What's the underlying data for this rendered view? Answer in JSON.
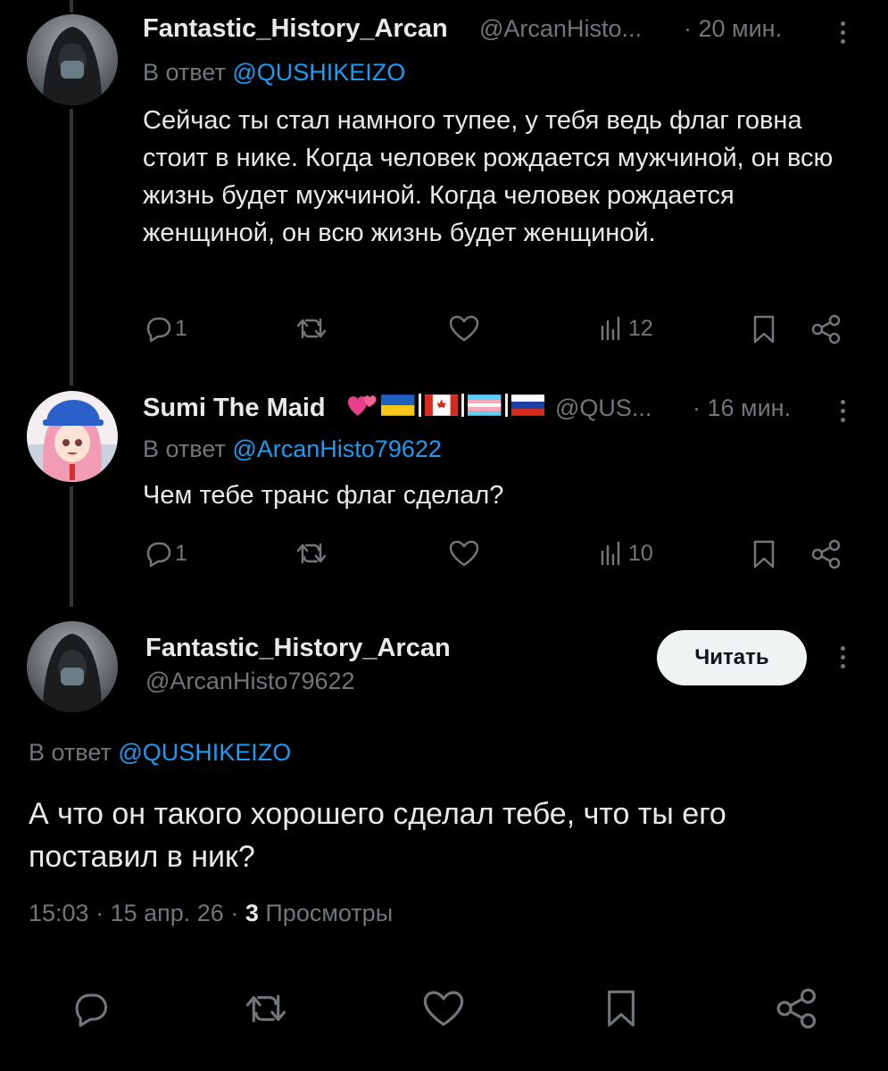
{
  "tweets": [
    {
      "name": "Fantastic_History_Arcan",
      "handle": "@ArcanHisto...",
      "time": "· 20 мин.",
      "reply_prefix": "В ответ",
      "reply_to": "@QUSHIKEIZO",
      "text": "Сейчас ты стал намного тупее, у тебя ведь флаг говна стоит в нике. Когда человек рождается мужчиной, он всю жизнь будет мужчиной. Когда человек рождается женщиной, он всю жизнь будет женщиной.",
      "replies": "1",
      "views": "12"
    },
    {
      "name": "Sumi The Maid",
      "name_emoji": "💕🇺🇦|🇨🇦|🏳️‍⚧️|🇷🇺",
      "handle": "@QUS...",
      "time": "· 16 мин.",
      "reply_prefix": "В ответ",
      "reply_to": "@ArcanHisto79622",
      "text": "Чем тебе транс флаг сделал?",
      "replies": "1",
      "views": "10"
    }
  ],
  "main": {
    "name": "Fantastic_History_Arcan",
    "handle": "@ArcanHisto79622",
    "follow_label": "Читать",
    "reply_prefix": "В ответ",
    "reply_to": "@QUSHIKEIZO",
    "text": "А что он такого хорошего сделал тебе, что ты его поставил в ник?",
    "time": "15:03",
    "date": "15 апр. 26",
    "views_count": "3",
    "views_label": "Просмотры"
  },
  "colors": {
    "background": "#000000",
    "text": "#e7e9ea",
    "muted": "#71767b",
    "link": "#1d9bf0",
    "button": "#eff3f4"
  },
  "icons": [
    "reply-icon",
    "retweet-icon",
    "like-icon",
    "views-icon",
    "bookmark-icon",
    "share-icon",
    "more-icon"
  ]
}
